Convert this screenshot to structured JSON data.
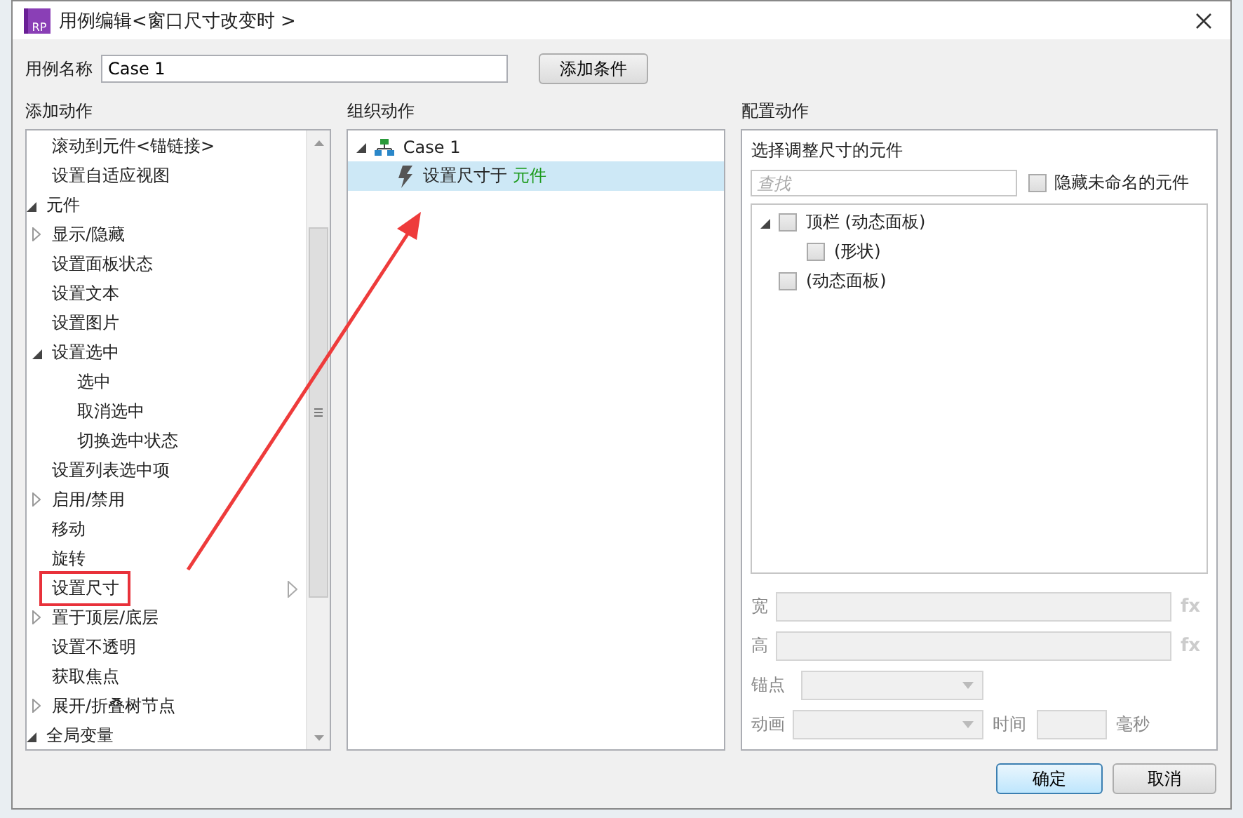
{
  "window": {
    "app_icon": "RP",
    "title": "用例编辑<窗口尺寸改变时 >"
  },
  "case_name": {
    "label": "用例名称",
    "value": "Case 1"
  },
  "add_condition_button": "添加条件",
  "add_actions": {
    "title": "添加动作",
    "tree": [
      {
        "children": [
          {
            "label": "滚动到元件<锚链接>"
          },
          {
            "label": "设置自适应视图"
          }
        ]
      },
      {
        "label": "元件",
        "expanded": true,
        "children": [
          {
            "label": "显示/隐藏",
            "expanded": false
          },
          {
            "label": "设置面板状态"
          },
          {
            "label": "设置文本"
          },
          {
            "label": "设置图片"
          },
          {
            "label": "设置选中",
            "expanded": true,
            "children": [
              {
                "label": "选中"
              },
              {
                "label": "取消选中"
              },
              {
                "label": "切换选中状态"
              }
            ]
          },
          {
            "label": "设置列表选中项"
          },
          {
            "label": "启用/禁用",
            "expanded": false
          },
          {
            "label": "移动"
          },
          {
            "label": "旋转"
          },
          {
            "label": "设置尺寸",
            "marked": true,
            "hovered": true
          },
          {
            "label": "置于顶层/底层",
            "expanded": false
          },
          {
            "label": "设置不透明"
          },
          {
            "label": "获取焦点"
          },
          {
            "label": "展开/折叠树节点",
            "expanded": false
          }
        ]
      },
      {
        "label": "全局变量",
        "expanded": true
      }
    ]
  },
  "organize_actions": {
    "title": "组织动作",
    "case": {
      "label": "Case 1",
      "expanded": true,
      "actions": [
        {
          "text": "设置尺寸于",
          "target": "元件",
          "selected": true
        }
      ]
    }
  },
  "configure_actions": {
    "title": "配置动作",
    "subtitle": "选择调整尺寸的元件",
    "search": {
      "placeholder": "查找"
    },
    "hide_unnamed": {
      "label": "隐藏未命名的元件",
      "checked": false
    },
    "widgets": [
      {
        "label": "顶栏 (动态面板)",
        "checked": false,
        "expanded": true,
        "children": [
          {
            "label": "(形状)",
            "checked": false
          }
        ]
      },
      {
        "label": "(动态面板)",
        "checked": false
      }
    ],
    "width_label": "宽",
    "height_label": "高",
    "width_fx": "fx",
    "height_fx": "fx",
    "anchor_label": "锚点",
    "animation_label": "动画",
    "time_label": "时间",
    "ms_label": "毫秒"
  },
  "buttons": [
    {
      "label": "确定",
      "default": true
    },
    {
      "label": "取消",
      "default": false
    }
  ]
}
